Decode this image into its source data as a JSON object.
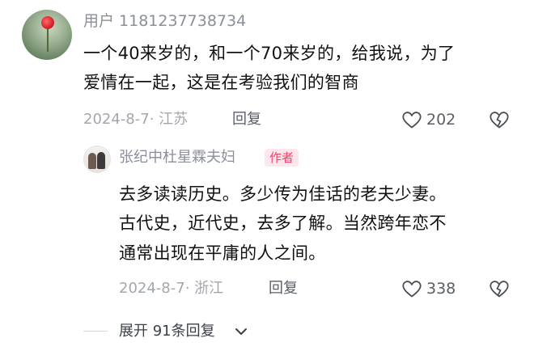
{
  "comment": {
    "username": "用户 1181237738734",
    "text_line1": "一个40来岁的，和一个70来岁的，给我说，为了",
    "text_line2": "爱情在一起，这是在考验我们的智商",
    "meta": "2024-8-7· 江苏",
    "reply_label": "回复",
    "like_count": "202",
    "like_icon": "heart-outline-icon",
    "dislike_icon": "broken-heart-icon"
  },
  "reply": {
    "author_name": "张纪中杜星霖夫妇",
    "author_badge": "作者",
    "text_line1": "去多读读历史。多少传为佳话的老夫少妻。",
    "text_line2": "古代史，近代史，去多了解。当然跨年恋不",
    "text_line3": "通常出现在平庸的人之间。",
    "meta": "2024-8-7· 浙江",
    "reply_label": "回复",
    "like_count": "338",
    "like_icon": "heart-outline-icon",
    "dislike_icon": "broken-heart-icon"
  },
  "expand": {
    "label": "展开 91条回复",
    "icon": "chevron-down-icon"
  },
  "colors": {
    "secondary_text": "#8a8f99",
    "meta_text": "#a2a7ae",
    "badge_bg": "#fde7ec",
    "badge_text": "#f0456a"
  }
}
